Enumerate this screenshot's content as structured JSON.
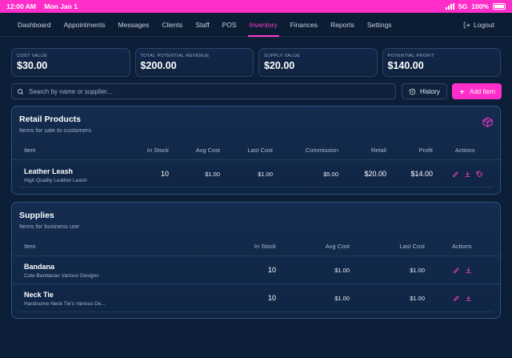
{
  "status_bar": {
    "time": "12:00 AM",
    "date": "Mon Jan 1",
    "network": "5G",
    "battery": "100%"
  },
  "nav": {
    "items": [
      "Dashboard",
      "Appointments",
      "Messages",
      "Clients",
      "Staff",
      "POS",
      "Inventory",
      "Finances",
      "Reports",
      "Settings"
    ],
    "active": "Inventory",
    "logout_label": "Logout"
  },
  "stats": [
    {
      "label": "COST VALUE",
      "value": "$30.00"
    },
    {
      "label": "TOTAL POTENTIAL REVENUE",
      "value": "$200.00"
    },
    {
      "label": "SUPPLY VALUE",
      "value": "$20.00"
    },
    {
      "label": "POTENTIAL PROFIT",
      "value": "$140.00"
    }
  ],
  "search": {
    "placeholder": "Search by name or supplier..."
  },
  "toolbar": {
    "history_label": "History",
    "add_label": "Add Item"
  },
  "retail": {
    "title": "Retail Products",
    "subtitle": "Items for sale to customers",
    "columns": [
      "Item",
      "In Stock",
      "Avg Cost",
      "Last Cost",
      "Commission",
      "Retail",
      "Profit",
      "Actions"
    ],
    "rows": [
      {
        "name": "Leather Leash",
        "desc": "High Quality Leather Leash",
        "in_stock": "10",
        "avg_cost": "$1.00",
        "last_cost": "$1.00",
        "commission": "$5.00",
        "retail": "$20.00",
        "profit": "$14.00"
      }
    ]
  },
  "supplies": {
    "title": "Supplies",
    "subtitle": "Items for business use",
    "columns": [
      "Item",
      "In Stock",
      "Avg Cost",
      "Last Cost",
      "Actions"
    ],
    "rows": [
      {
        "name": "Bandana",
        "desc": "Cute Bandanas Various Designs",
        "in_stock": "10",
        "avg_cost": "$1.00",
        "last_cost": "$1.00"
      },
      {
        "name": "Neck Tie",
        "desc": "Handsome Neck Tie's Various De...",
        "in_stock": "10",
        "avg_cost": "$1.00",
        "last_cost": "$1.00"
      }
    ]
  },
  "colors": {
    "accent": "#ff2ec9",
    "background": "#0d1f38",
    "panel_border": "#2f4f78"
  },
  "icons": [
    "search-icon",
    "history-icon",
    "plus-icon",
    "box-icon",
    "edit-icon",
    "download-icon",
    "tag-icon",
    "logout-icon",
    "signal-icon",
    "battery-icon"
  ]
}
